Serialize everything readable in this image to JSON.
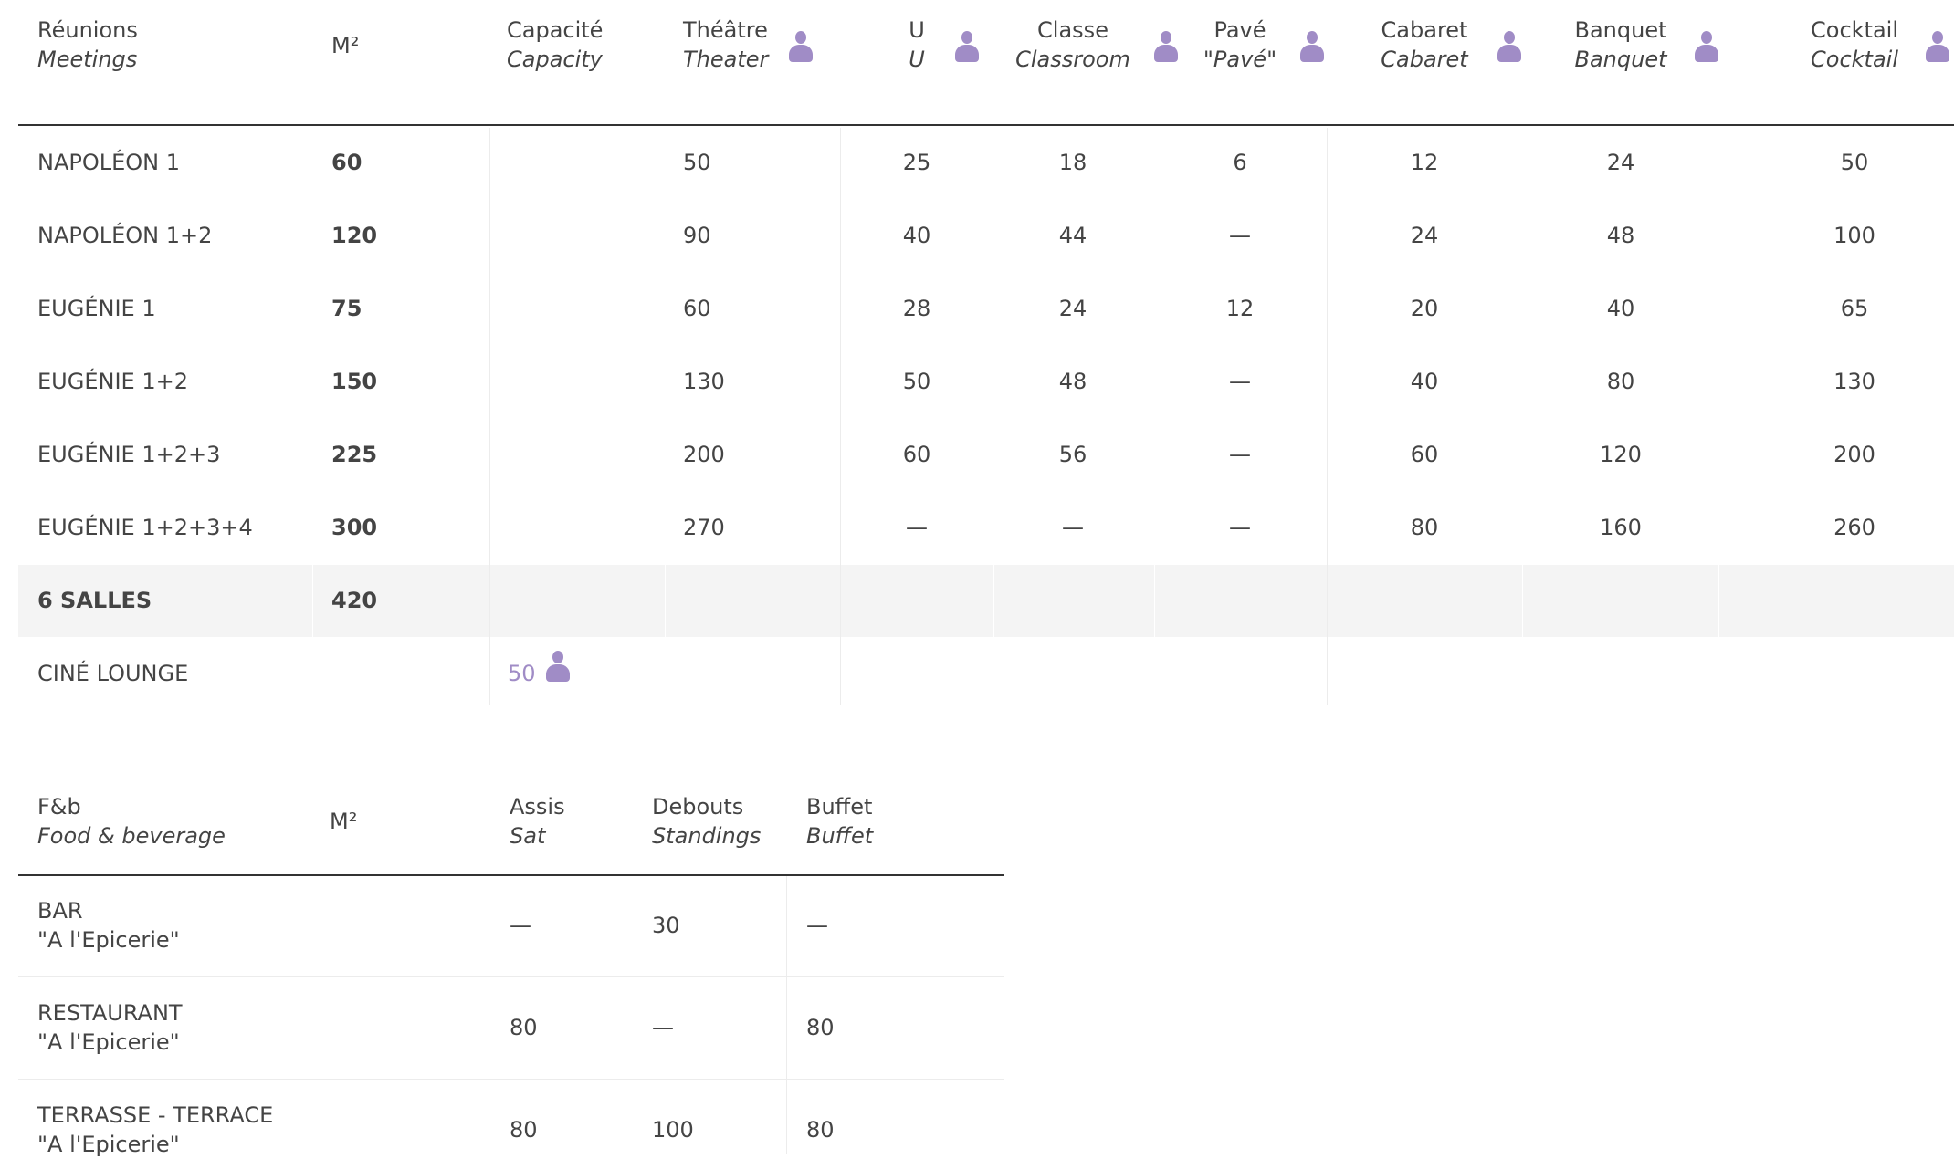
{
  "meetings": {
    "headers": {
      "name": {
        "fr": "Réunions",
        "en": "Meetings"
      },
      "m2": "M²",
      "capacity": {
        "fr": "Capacité",
        "en": "Capacity"
      },
      "theatre": {
        "fr": "Théâtre",
        "en": "Theater"
      },
      "u": {
        "fr": "U",
        "en": "U"
      },
      "classroom": {
        "fr": "Classe",
        "en": "Classroom"
      },
      "pave": {
        "fr": "Pavé",
        "en": "\"Pavé\""
      },
      "cabaret": {
        "fr": "Cabaret",
        "en": "Cabaret"
      },
      "banquet": {
        "fr": "Banquet",
        "en": "Banquet"
      },
      "cocktail": {
        "fr": "Cocktail",
        "en": "Cocktail"
      }
    },
    "rows": [
      {
        "name": "NAPOLÉON 1",
        "m2": "60",
        "theatre": "50",
        "u": "25",
        "classroom": "18",
        "pave": "6",
        "cabaret": "12",
        "banquet": "24",
        "cocktail": "50"
      },
      {
        "name": "NAPOLÉON 1+2",
        "m2": "120",
        "theatre": "90",
        "u": "40",
        "classroom": "44",
        "pave": "—",
        "cabaret": "24",
        "banquet": "48",
        "cocktail": "100"
      },
      {
        "name": "EUGÉNIE 1",
        "m2": "75",
        "theatre": "60",
        "u": "28",
        "classroom": "24",
        "pave": "12",
        "cabaret": "20",
        "banquet": "40",
        "cocktail": "65"
      },
      {
        "name": "EUGÉNIE 1+2",
        "m2": "150",
        "theatre": "130",
        "u": "50",
        "classroom": "48",
        "pave": "—",
        "cabaret": "40",
        "banquet": "80",
        "cocktail": "130"
      },
      {
        "name": "EUGÉNIE 1+2+3",
        "m2": "225",
        "theatre": "200",
        "u": "60",
        "classroom": "56",
        "pave": "—",
        "cabaret": "60",
        "banquet": "120",
        "cocktail": "200"
      },
      {
        "name": "EUGÉNIE 1+2+3+4",
        "m2": "300",
        "theatre": "270",
        "u": "—",
        "classroom": "—",
        "pave": "—",
        "cabaret": "80",
        "banquet": "160",
        "cocktail": "260"
      }
    ],
    "total": {
      "name": "6 SALLES",
      "m2": "420"
    },
    "lounge": {
      "name": "CINÉ LOUNGE",
      "capacity": "50"
    }
  },
  "fnb": {
    "headers": {
      "name": {
        "fr": "F&b",
        "en": "Food & beverage"
      },
      "m2": "M²",
      "sat": {
        "fr": "Assis",
        "en": "Sat"
      },
      "standing": {
        "fr": "Debouts",
        "en": "Standings"
      },
      "buffet": {
        "fr": "Buffet",
        "en": "Buffet"
      }
    },
    "rows": [
      {
        "name": "BAR",
        "sub": "\"A l'Epicerie\"",
        "sat": "—",
        "standing": "30",
        "buffet": "—"
      },
      {
        "name": "RESTAURANT",
        "sub": "\"A l'Epicerie\"",
        "sat": "80",
        "standing": "—",
        "buffet": "80"
      },
      {
        "name": "TERRASSE - TERRACE",
        "sub": "\"A l'Epicerie\"",
        "sat": "80",
        "standing": "100",
        "buffet": "80"
      }
    ]
  },
  "colors": {
    "accent": "#a08cc6",
    "text": "#444444",
    "rule": "#333333"
  },
  "icons": [
    "person-icon"
  ]
}
